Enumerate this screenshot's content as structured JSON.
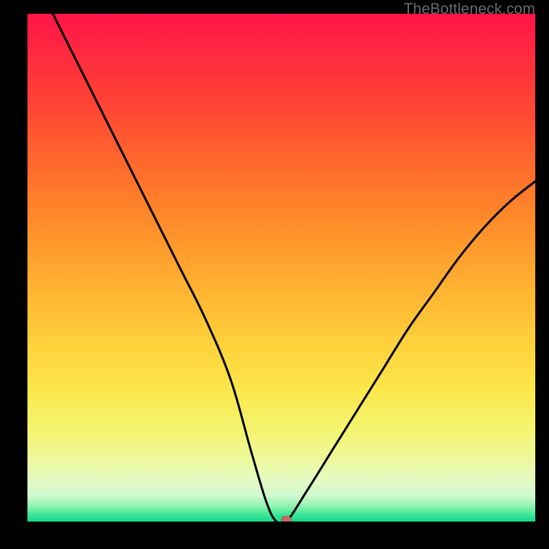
{
  "watermark": "TheBottleneck.com",
  "chart_data": {
    "type": "line",
    "title": "",
    "xlabel": "",
    "ylabel": "",
    "xlim": [
      0,
      100
    ],
    "ylim": [
      0,
      100
    ],
    "grid": false,
    "legend": false,
    "series": [
      {
        "name": "bottleneck-curve",
        "x": [
          5,
          10,
          15,
          20,
          25,
          30,
          35,
          40,
          44,
          47,
          49,
          51,
          55,
          60,
          65,
          70,
          75,
          80,
          85,
          90,
          95,
          100
        ],
        "y": [
          100,
          90,
          80,
          70,
          60,
          50,
          40,
          28,
          14,
          4,
          0,
          0,
          6,
          14,
          22,
          30,
          38,
          45,
          52,
          58,
          63,
          67
        ]
      }
    ],
    "marker": {
      "x": 51,
      "y": 0,
      "color": "#c66a5c"
    },
    "gradient_stops": [
      {
        "pos": 0,
        "color": "#ff1447"
      },
      {
        "pos": 50,
        "color": "#ffcc33"
      },
      {
        "pos": 85,
        "color": "#f4f471"
      },
      {
        "pos": 100,
        "color": "#17d98b"
      }
    ]
  }
}
